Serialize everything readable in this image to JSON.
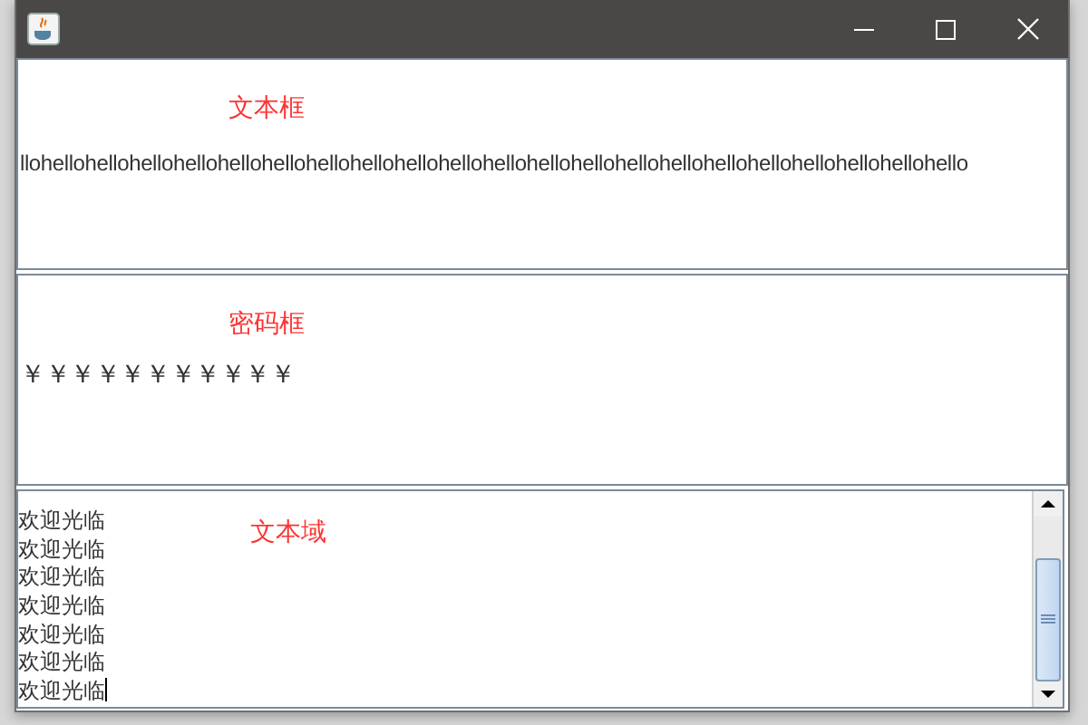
{
  "window": {
    "title_bar_buttons": [
      {
        "kind": "minimize"
      },
      {
        "kind": "maximize"
      },
      {
        "kind": "close"
      }
    ]
  },
  "text_field_panel": {
    "label": "文本框",
    "value": "llohellohellohellohellohellohellohellohellohellohellohellohellohellohellohellohellohellohellohellohellohello"
  },
  "password_panel": {
    "label": "密码框",
    "value": "￥￥￥￥￥￥￥￥￥￥￥"
  },
  "text_area": {
    "label": "文本域",
    "lines": [
      "欢迎光临",
      "欢迎光临",
      "欢迎光临",
      "欢迎光临",
      "欢迎光临",
      "欢迎光临",
      "欢迎光临"
    ]
  }
}
